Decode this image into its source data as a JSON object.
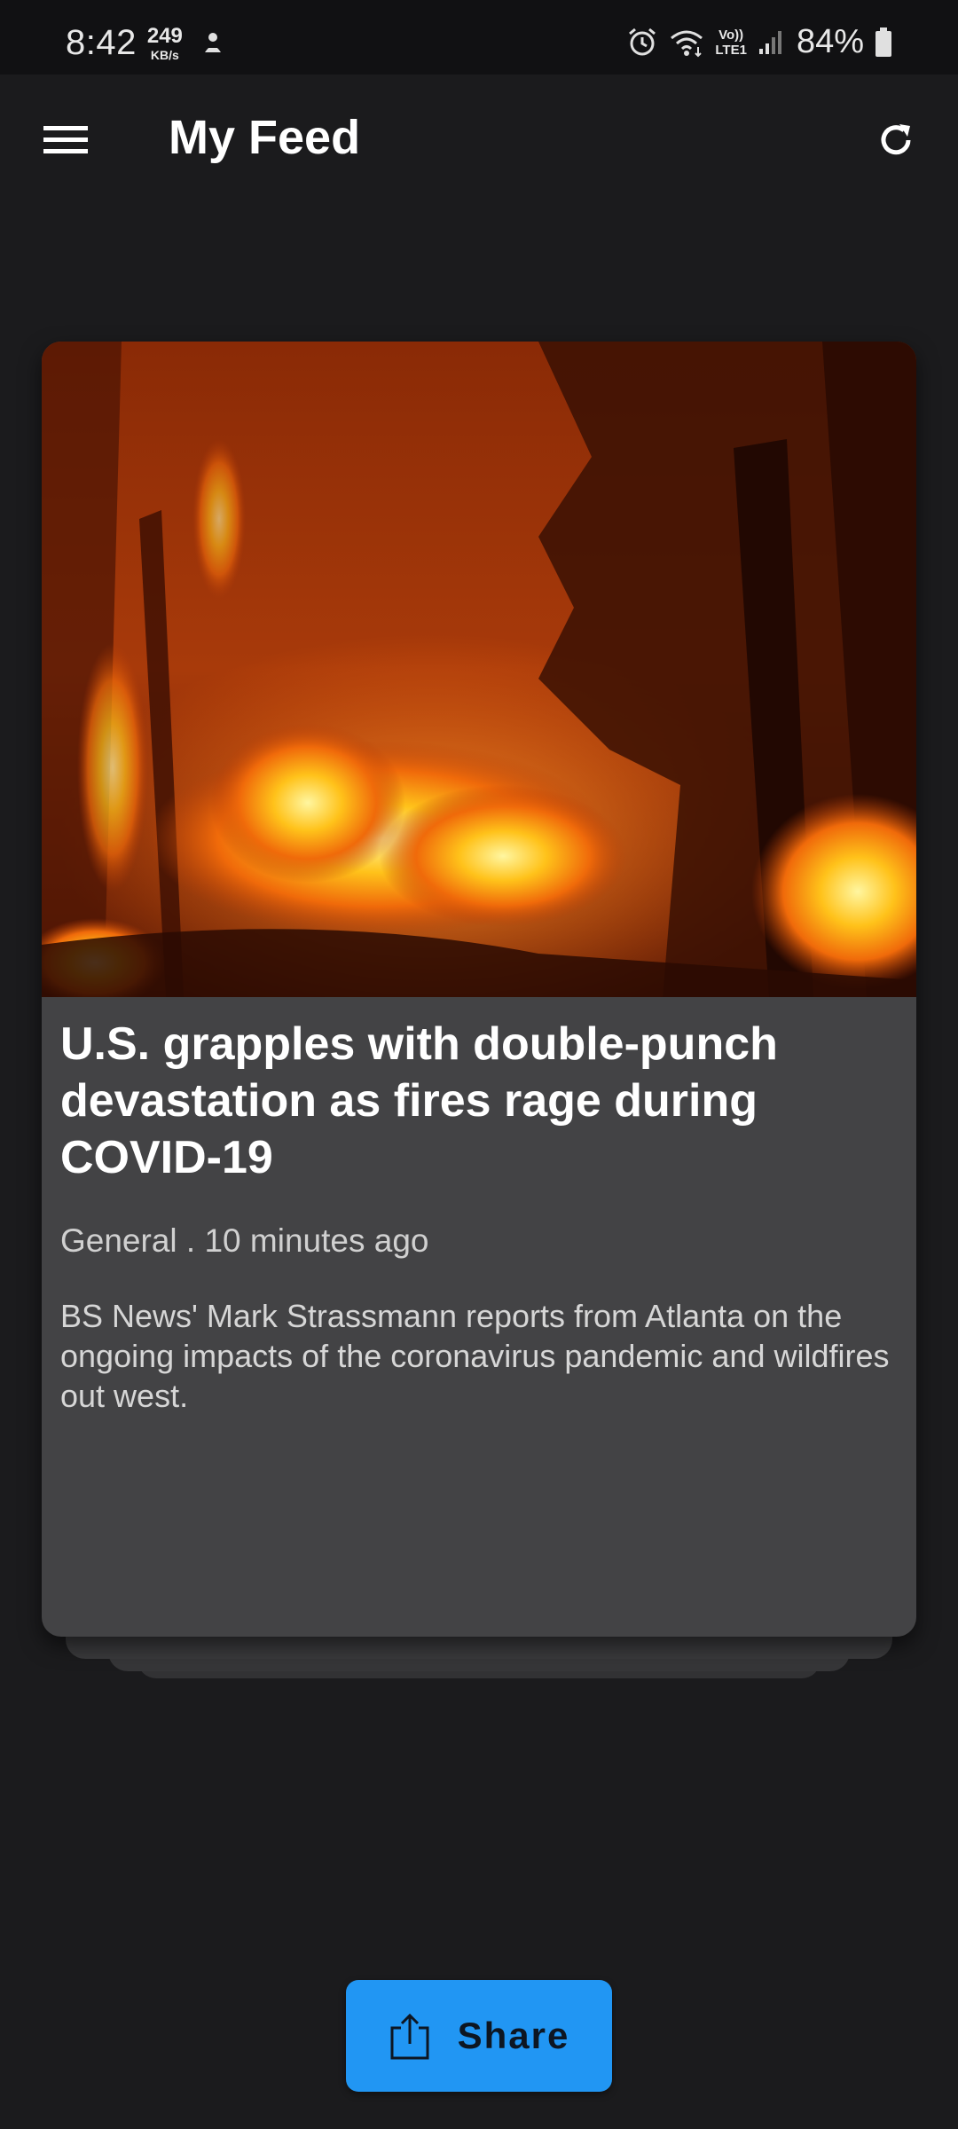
{
  "status_bar": {
    "time": "8:42",
    "net_speed": "249",
    "net_unit": "KB/s",
    "lte_top": "Vo))",
    "lte_bottom": "LTE1",
    "battery": "84%",
    "icons": [
      "alarm-icon",
      "wifi-icon",
      "signal-icon",
      "battery-icon"
    ]
  },
  "app_bar": {
    "title": "My Feed",
    "menu_icon": "hamburger-menu-icon",
    "refresh_icon": "refresh-icon"
  },
  "card": {
    "image_alt": "wildfire-image",
    "title": "U.S. grapples with double-punch devastation as fires rage during COVID-19",
    "meta": "General . 10 minutes ago",
    "description": "BS News' Mark Strassmann reports from Atlanta on the ongoing impacts of the coronavirus pandemic and wildfires out west."
  },
  "share_button": {
    "label": "Share",
    "icon": "share-icon"
  },
  "colors": {
    "background": "#1b1b1d",
    "card": "#434345",
    "accent": "#2196f3"
  }
}
